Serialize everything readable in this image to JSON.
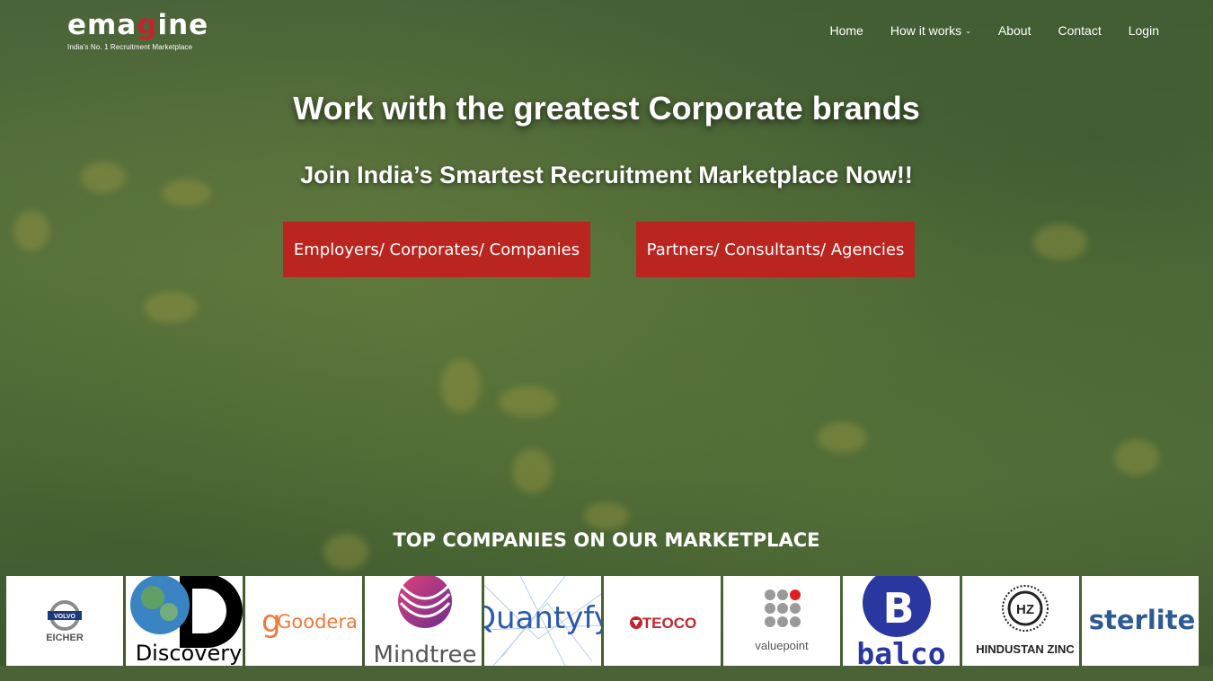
{
  "brand": {
    "logo_left": "ema",
    "logo_g": "g",
    "logo_right": "ine",
    "tagline": "India's No. 1 Recruitment Marketplace"
  },
  "nav": {
    "items": [
      {
        "label": "Home"
      },
      {
        "label": "How it works",
        "has_dropdown": true
      },
      {
        "label": "About"
      },
      {
        "label": "Contact"
      },
      {
        "label": "Login"
      }
    ]
  },
  "hero": {
    "title": "Work with the greatest Corporate brands",
    "subtitle": "Join India’s Smartest Recruitment Marketplace Now!!",
    "cta_employers": "Employers/ Corporates/ Companies",
    "cta_partners": "Partners/ Consultants/ Agencies"
  },
  "companies": {
    "heading": "TOP COMPANIES ON OUR MARKETPLACE",
    "logos": [
      {
        "name": "EICHER",
        "badge": "VOLVO"
      },
      {
        "name": "Discovery"
      },
      {
        "name": "Goodera",
        "mark": "g"
      },
      {
        "name": "Mindtree"
      },
      {
        "name": "Quantyfy"
      },
      {
        "name": "TEOCO"
      },
      {
        "name": "valuepoint"
      },
      {
        "name": "balco",
        "mark": "B"
      },
      {
        "name": "HINDUSTAN ZINC",
        "mark": "HZ"
      },
      {
        "name": "sterlite"
      }
    ]
  },
  "colors": {
    "accent": "#ba2520",
    "logo_red": "#c0272d",
    "grass": "#56703e"
  }
}
